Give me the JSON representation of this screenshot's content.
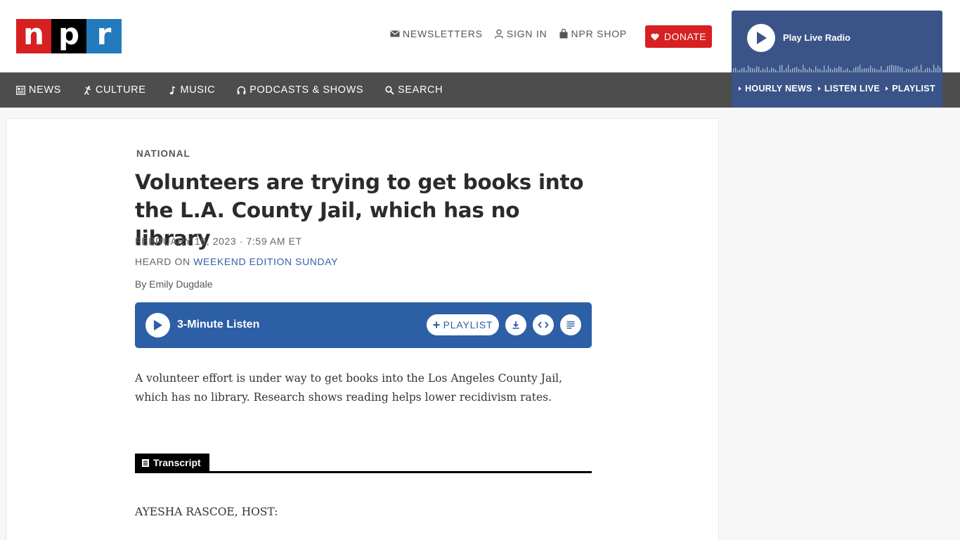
{
  "logo": {
    "letters": [
      "n",
      "p",
      "r"
    ]
  },
  "utility_nav": {
    "newsletters": "NEWSLETTERS",
    "sign_in": "SIGN IN",
    "shop": "NPR SHOP",
    "donate": "DONATE"
  },
  "main_nav": {
    "news": "NEWS",
    "culture": "CULTURE",
    "music": "MUSIC",
    "podcasts": "PODCASTS & SHOWS",
    "search": "SEARCH"
  },
  "live_radio": {
    "title": "Play Live Radio",
    "links": [
      "HOURLY NEWS",
      "LISTEN LIVE",
      "PLAYLIST"
    ]
  },
  "article": {
    "section": "NATIONAL",
    "headline": "Volunteers are trying to get books into the L.A. County Jail, which has no library",
    "dateline": "FEBRUARY 19, 2023 · 7:59 AM ET",
    "heard_on_prefix": "HEARD ON",
    "heard_on_show": "WEEKEND EDITION SUNDAY",
    "byline": "By Emily Dugdale",
    "teaser": "A volunteer effort is under way to get books into the Los Angeles County Jail, which has no library. Research shows reading helps lower recidivism rates.",
    "transcript_label": "Transcript",
    "first_speaker": "AYESHA RASCOE, HOST:"
  },
  "audio": {
    "label": "3-Minute Listen",
    "playlist_label": "PLAYLIST"
  },
  "colors": {
    "npr_red": "#d62021",
    "npr_blue": "#237bbd",
    "nav_bg": "#4d4d4d",
    "radio_bg": "#3a5488",
    "audio_bg": "#2d5fa6"
  }
}
